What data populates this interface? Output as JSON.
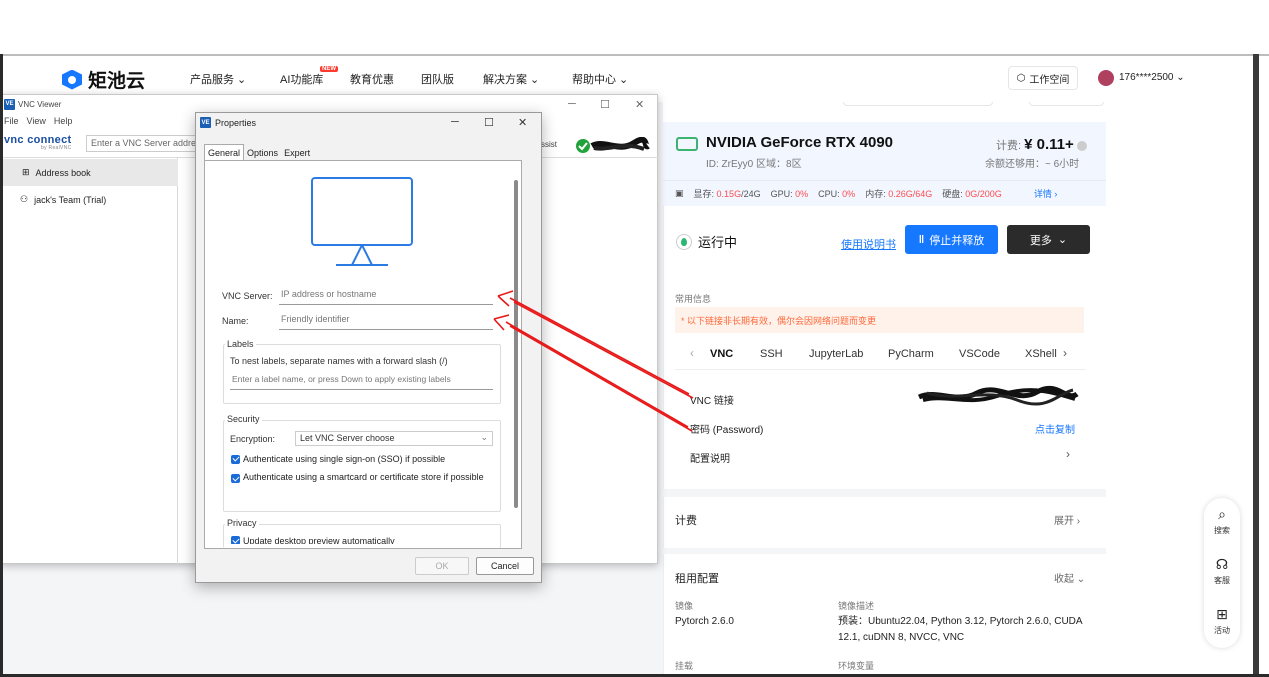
{
  "site": {
    "logo_text": "矩池云",
    "nav": [
      "产品服务",
      "AI功能库",
      "教育优惠",
      "团队版",
      "解决方案",
      "帮助中心"
    ],
    "new_badge": "NEW",
    "workspace": "工作空间",
    "user": "176****2500"
  },
  "instance": {
    "gpu_name": "NVIDIA GeForce RTX 4090",
    "id_line": "ID: ZrEyy0   区域：8区",
    "fee_label": "计费:",
    "fee_value": "¥ 0.11+",
    "balance": "余额还够用：~ 6小时",
    "stats": {
      "vram_label": "显存:",
      "vram_value": "0.15G",
      "vram_total": "/24G",
      "gpu_label": "GPU:",
      "gpu_value": "0%",
      "cpu_label": "CPU:",
      "cpu_value": "0%",
      "mem_label": "内存:",
      "mem_value": "0.26G/64G",
      "disk_label": "硬盘:",
      "disk_value": "0G/200G",
      "detail": "详情"
    },
    "status": "运行中",
    "manual": "使用说明书",
    "stop": "停止并释放",
    "more": "更多",
    "common_info": "常用信息",
    "warning": "* 以下链接非长期有效，偶尔会因网络问题而变更",
    "tabs": [
      "VNC",
      "SSH",
      "JupyterLab",
      "PyCharm",
      "VSCode",
      "XShell"
    ],
    "vnc_link_label": "VNC 链接",
    "password_label": "密码 (Password)",
    "copy": "点击复制",
    "config_label": "配置说明",
    "billing": "计费",
    "expand": "展开",
    "rent_config": "租用配置",
    "collapse": "收起",
    "image_label": "镜像",
    "image_value": "Pytorch 2.6.0",
    "image_desc_label": "镜像描述",
    "image_desc": "预装：Ubuntu22.04, Python 3.12, Pytorch 2.6.0, CUDA 12.1, cuDNN 8, NVCC, VNC",
    "mount_label": "挂载",
    "env_label": "环境变量"
  },
  "float_bar": [
    "搜索",
    "客服",
    "活动"
  ],
  "vnc_viewer": {
    "title": "VNC Viewer",
    "menu": [
      "File",
      "View",
      "Help"
    ],
    "logo": "vnc connect",
    "logo_sub": "by RealVNC",
    "address_placeholder": "Enter a VNC Server address",
    "assist": "ssist",
    "address_book": "Address book",
    "team": "jack's Team (Trial)"
  },
  "properties": {
    "title": "Properties",
    "tabs": [
      "General",
      "Options",
      "Expert"
    ],
    "vnc_server_label": "VNC Server:",
    "vnc_server_placeholder": "IP address or hostname",
    "name_label": "Name:",
    "name_placeholder": "Friendly identifier",
    "labels_group": "Labels",
    "labels_hint": "To nest labels, separate names with a forward slash (/)",
    "labels_placeholder": "Enter a label name, or press Down to apply existing labels",
    "security_group": "Security",
    "encryption_label": "Encryption:",
    "encryption_value": "Let VNC Server choose",
    "sso": "Authenticate using single sign-on (SSO) if possible",
    "smartcard": "Authenticate using a smartcard or certificate store if possible",
    "privacy_group": "Privacy",
    "privacy_item": "Update desktop preview automatically",
    "ok": "OK",
    "cancel": "Cancel"
  },
  "colors": {
    "brand_blue": "#1677ff",
    "running_green": "#2bb673",
    "warning_orange": "#ff6a3d",
    "stat_red": "#ff4d4f",
    "arrow_red": "#e81919"
  }
}
